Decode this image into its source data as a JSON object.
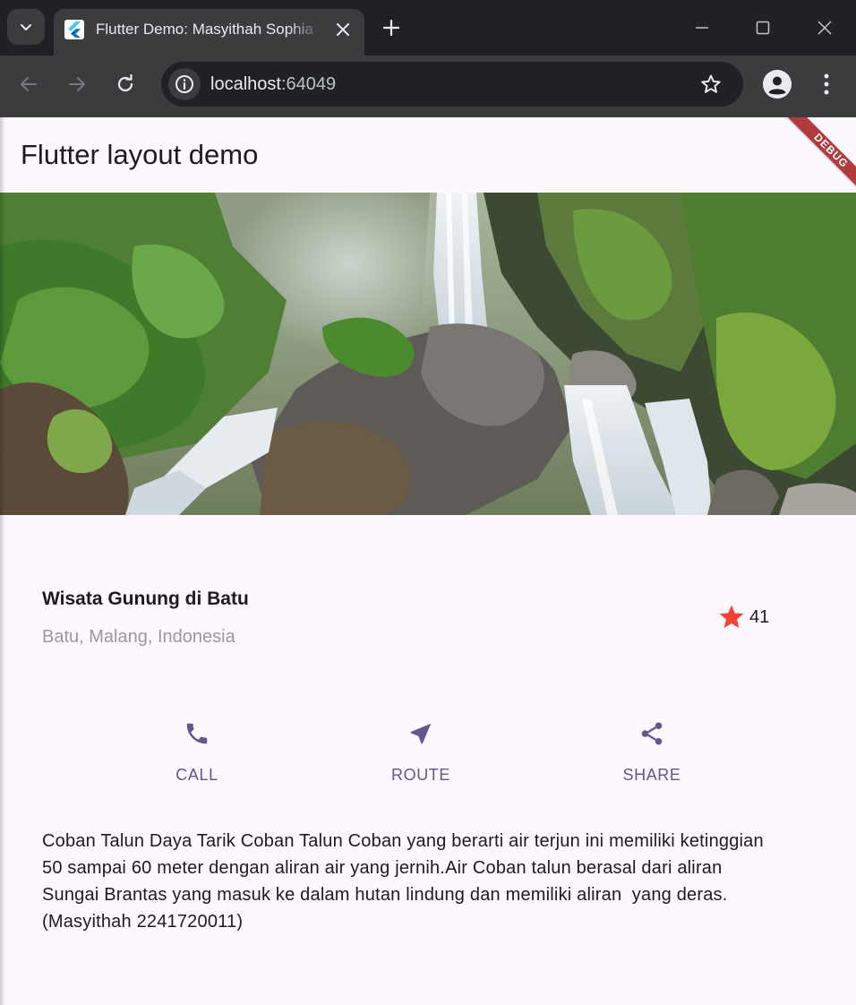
{
  "browser": {
    "tab_title": "Flutter Demo: Masyithah Sophia",
    "url_host": "localhost",
    "url_port": ":64049"
  },
  "app": {
    "title": "Flutter layout demo",
    "debug_label": "DEBUG",
    "place": {
      "name": "Wisata Gunung di Batu",
      "location": "Batu, Malang, Indonesia",
      "rating_count": "41"
    },
    "actions": [
      {
        "label": "CALL",
        "icon": "phone-icon"
      },
      {
        "label": "ROUTE",
        "icon": "near-me-icon"
      },
      {
        "label": "SHARE",
        "icon": "share-icon"
      }
    ],
    "description": "Coban Talun Daya Tarik Coban Talun Coban yang berarti air terjun ini memiliki ketinggian\n50 sampai 60 meter dengan aliran air yang jernih.Air Coban talun berasal dari aliran\nSungai Brantas yang masuk ke dalam hutan lindung dan memiliki aliran  yang deras.\n(Masyithah 2241720011)"
  },
  "colors": {
    "accent": "#65558f",
    "star": "#f44336",
    "background": "#fdf7fe",
    "debug_banner": "#b13b3d"
  }
}
